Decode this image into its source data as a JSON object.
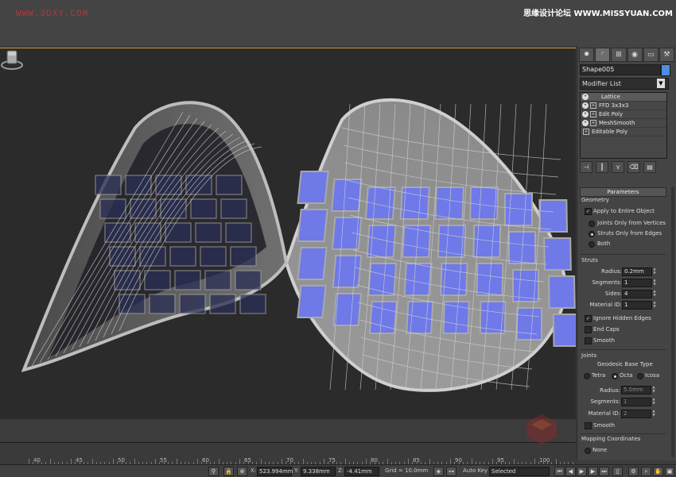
{
  "watermarks": {
    "left": "WWW.3DXY.COM",
    "right": "思缘设计论坛 WWW.MISSYUAN.COM"
  },
  "command_panel": {
    "tabs": [
      "create-icon",
      "modify-icon",
      "hierarchy-icon",
      "motion-icon",
      "display-icon",
      "utilities-icon"
    ],
    "object_name": "Shape005",
    "object_color": "#4a8fe2",
    "modifier_list_label": "Modifier List",
    "stack": [
      {
        "label": "Lattice",
        "active": true
      },
      {
        "label": "FFD 3x3x3",
        "active": false
      },
      {
        "label": "Edit Poly",
        "active": false
      },
      {
        "label": "MeshSmooth",
        "active": false
      },
      {
        "label": "Editable Poly",
        "active": false
      }
    ],
    "parameters": {
      "title": "Parameters",
      "geometry_label": "Geometry",
      "apply_entire": "Apply to Entire Object",
      "joints_only": "Joints Only from Vertices",
      "struts_only": "Struts Only from Edges",
      "both": "Both",
      "struts_label": "Struts",
      "radius_label": "Radius:",
      "radius_value": "0.2mm",
      "segments_label": "Segments:",
      "segments_value": "1",
      "sides_label": "Sides:",
      "sides_value": "4",
      "material_id_label": "Material ID:",
      "material_id_value": "1",
      "ignore_hidden": "Ignore Hidden Edges",
      "end_caps": "End Caps",
      "smooth": "Smooth",
      "joints_label": "Joints",
      "geodesic_label": "Geodesic Base Type",
      "tetra": "Tetra",
      "octa": "Octa",
      "icosa": "Icosa",
      "j_radius_value": "5.0mm",
      "j_segments_value": "1",
      "j_material_id_value": "2",
      "j_smooth": "Smooth",
      "mapping_label": "Mapping Coordinates",
      "none": "None"
    }
  },
  "timeline": {
    "numbers": [
      "40",
      "45",
      "50",
      "55",
      "60",
      "65",
      "70",
      "75",
      "80",
      "85",
      "90",
      "95",
      "100"
    ]
  },
  "statusbar": {
    "x_label": "X:",
    "x_value": "523.994mm",
    "y_label": "Y:",
    "y_value": "9.338mm",
    "z_label": "Z:",
    "z_value": "-4.41mm",
    "grid": "Grid = 10.0mm",
    "auto_key": "Auto Key",
    "selected": "Selected"
  },
  "colors": {
    "accent_line": "#c49a36",
    "glass": "#6f79e8",
    "viewport_bg": "#2b2b2b"
  }
}
